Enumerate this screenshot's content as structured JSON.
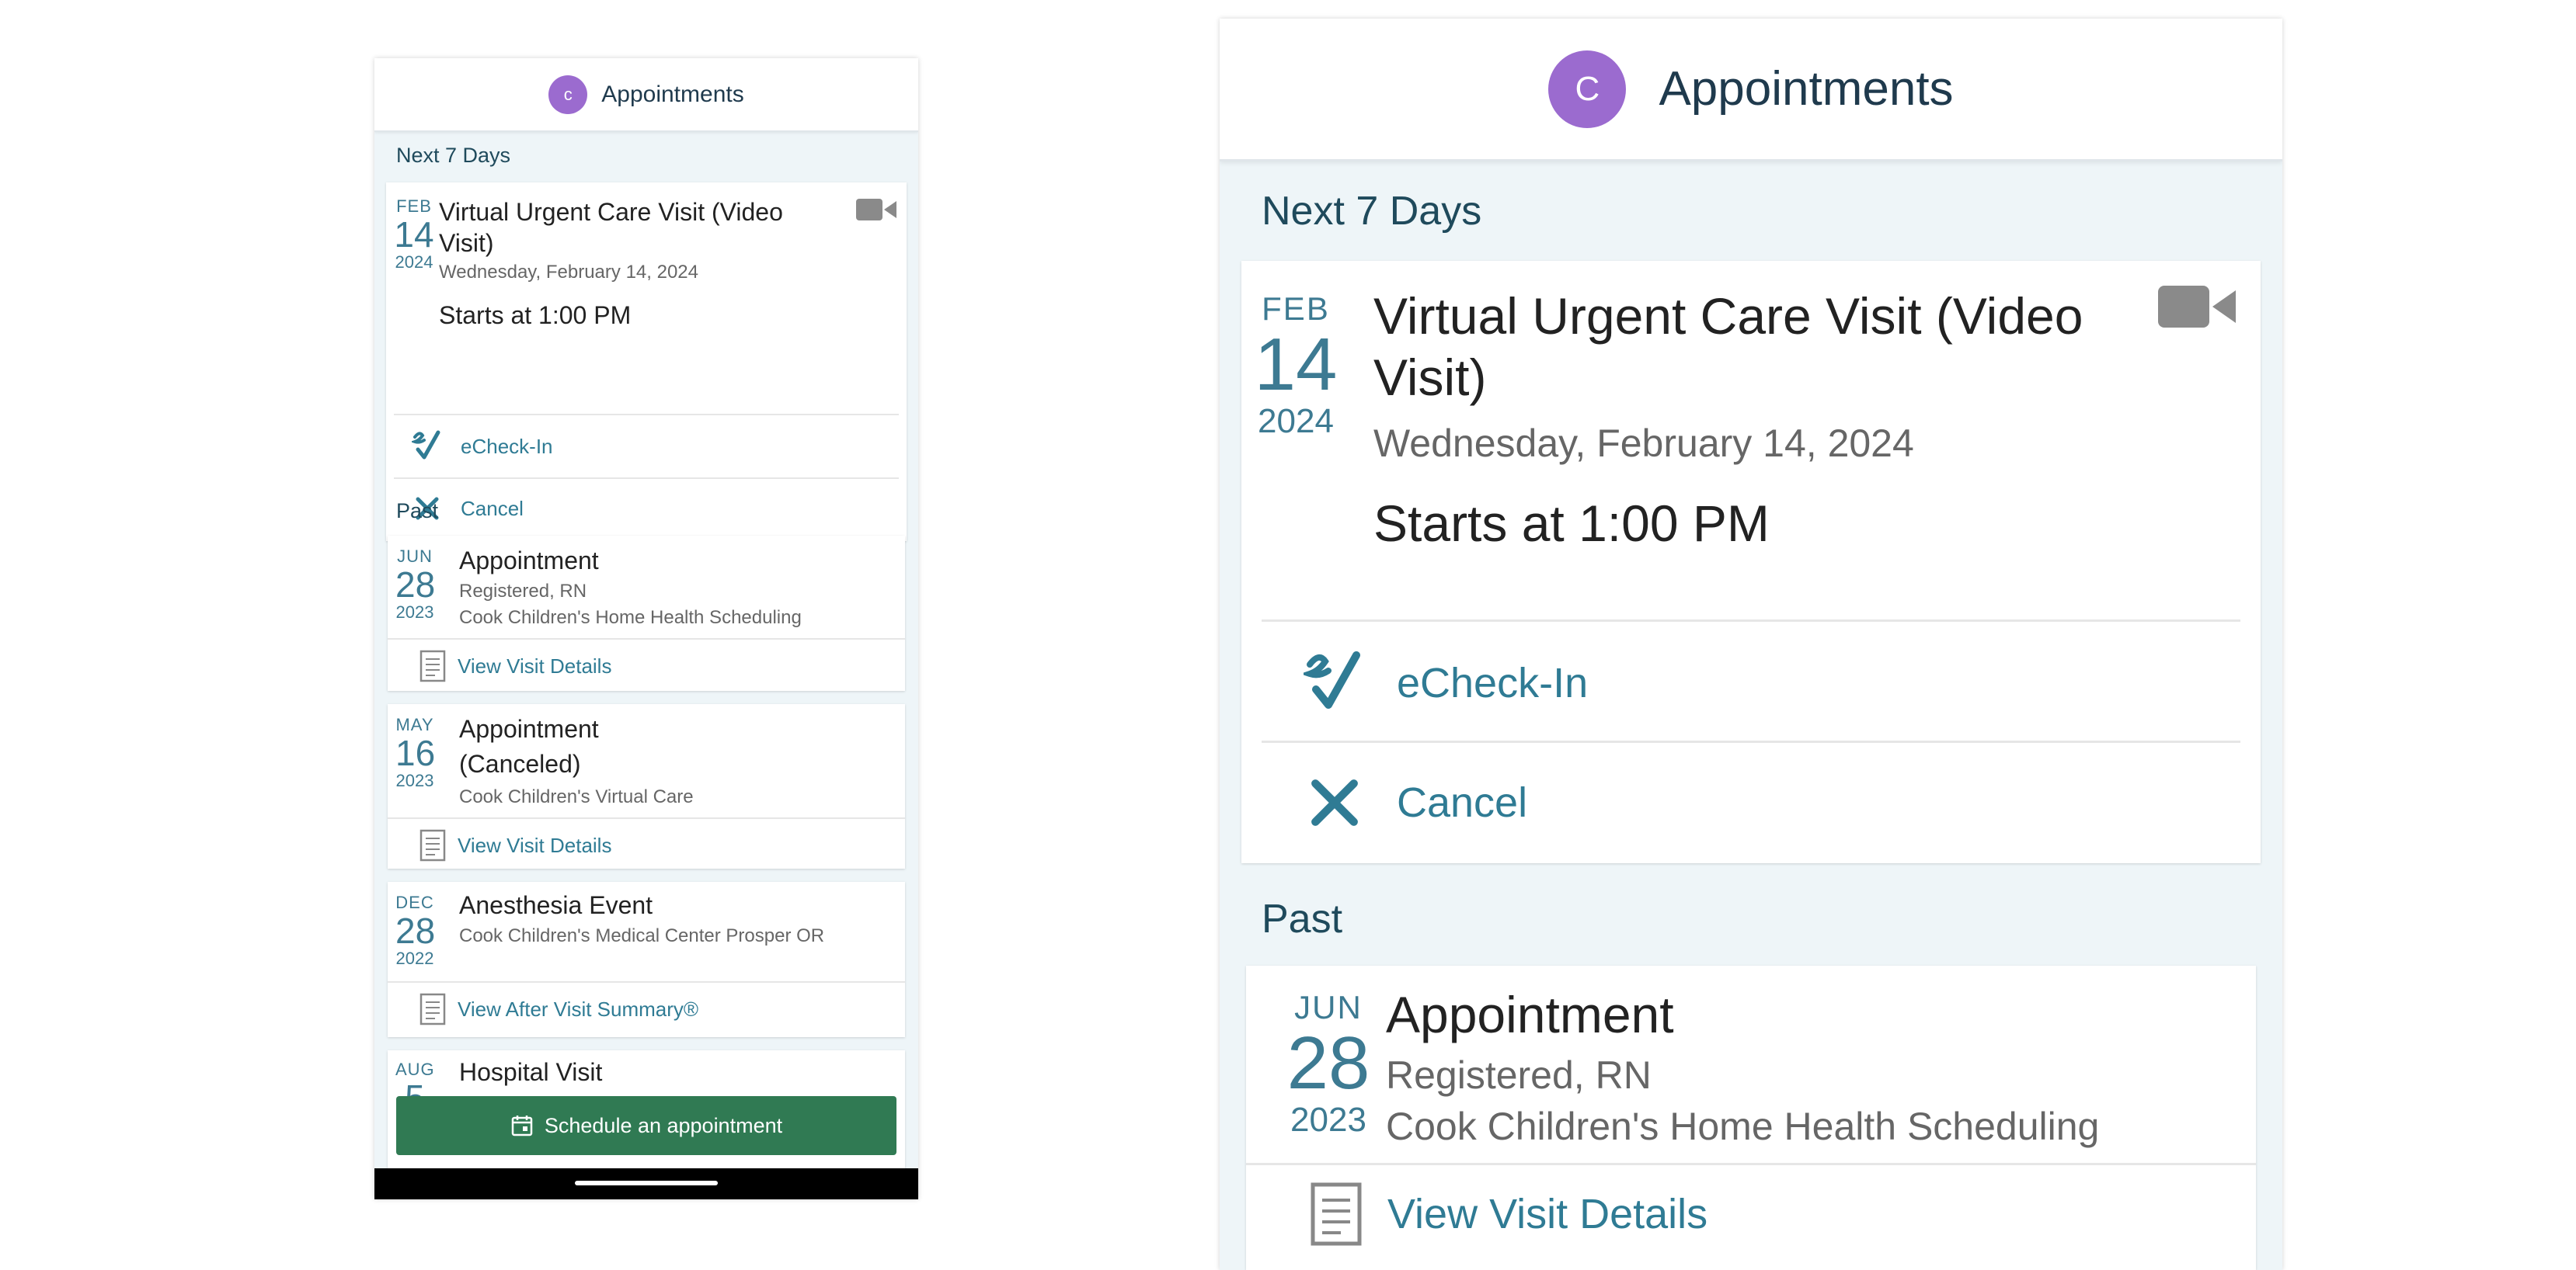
{
  "header": {
    "avatar_initial": "C",
    "avatar_initial_small": "c",
    "title": "Appointments"
  },
  "sections": {
    "upcoming": "Next 7 Days",
    "past": "Past"
  },
  "upcoming": {
    "month": "FEB",
    "day": "14",
    "year": "2024",
    "title_line1": "Virtual Urgent Care Visit (Video",
    "title_line2": "Visit)",
    "date_text": "Wednesday, February 14, 2024",
    "starts": "Starts at 1:00 PM",
    "icon": "video-camera-icon",
    "actions": {
      "echeckin": "eCheck-In",
      "cancel": "Cancel"
    }
  },
  "past": [
    {
      "month": "JUN",
      "day": "28",
      "year": "2023",
      "title": "Appointment",
      "line1": "Registered, RN",
      "line2": "Cook Children's Home Health Scheduling",
      "action": "View Visit Details"
    },
    {
      "month": "MAY",
      "day": "16",
      "year": "2023",
      "title_line1": "Appointment",
      "title_line2": "(Canceled)",
      "line1": "Cook Children's Virtual Care",
      "action": "View Visit Details"
    },
    {
      "month": "DEC",
      "day": "28",
      "year": "2022",
      "title": "Anesthesia Event",
      "line1": "Cook Children's Medical Center Prosper OR",
      "action": "View After Visit Summary®"
    },
    {
      "month": "AUG",
      "day": "5",
      "title": "Hospital Visit"
    }
  ],
  "schedule_button": "Schedule an appointment",
  "colors": {
    "accent": "#3d7a92",
    "link": "#2f7b94",
    "primary_button": "#307a53",
    "avatar": "#9b6bcf",
    "background": "#eef5f8"
  }
}
